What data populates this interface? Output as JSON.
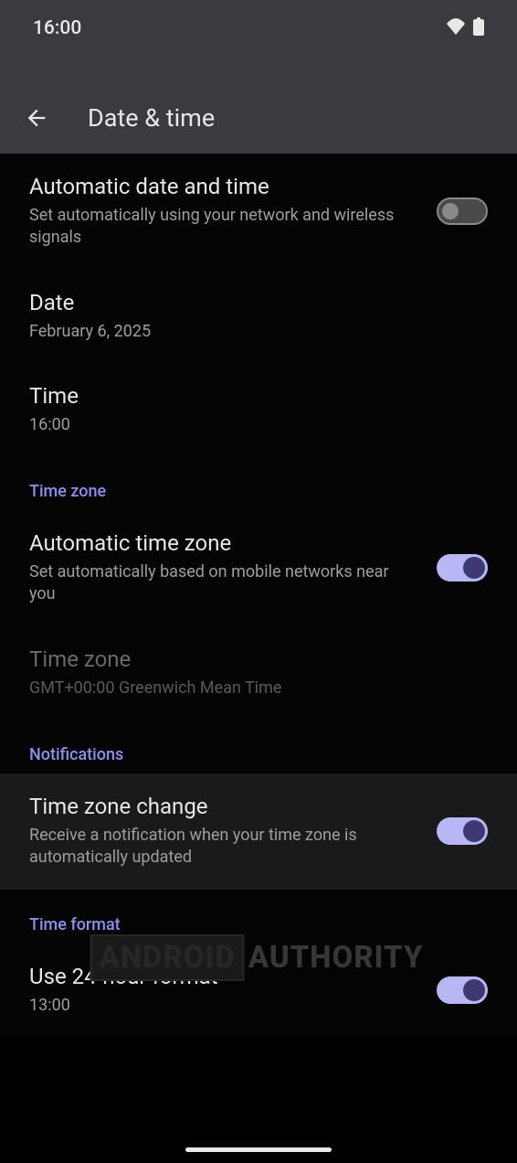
{
  "statusBar": {
    "time": "16:00"
  },
  "appBar": {
    "title": "Date & time"
  },
  "settings": {
    "autoDateTime": {
      "title": "Automatic date and time",
      "subtitle": "Set automatically using your network and wireless signals",
      "enabled": false
    },
    "date": {
      "title": "Date",
      "value": "February 6, 2025"
    },
    "time": {
      "title": "Time",
      "value": "16:00"
    }
  },
  "sections": {
    "timeZone": {
      "header": "Time zone",
      "autoTimeZone": {
        "title": "Automatic time zone",
        "subtitle": "Set automatically based on mobile networks near you",
        "enabled": true
      },
      "timeZone": {
        "title": "Time zone",
        "value": "GMT+00:00 Greenwich Mean Time"
      }
    },
    "notifications": {
      "header": "Notifications",
      "timeZoneChange": {
        "title": "Time zone change",
        "subtitle": "Receive a notification when your time zone is automatically updated",
        "enabled": true
      }
    },
    "timeFormat": {
      "header": "Time format",
      "use24Hour": {
        "title": "Use 24-hour format",
        "example": "13:00",
        "enabled": true
      }
    }
  },
  "watermark": {
    "part1": "ANDROID",
    "part2": "AUTHORITY"
  }
}
